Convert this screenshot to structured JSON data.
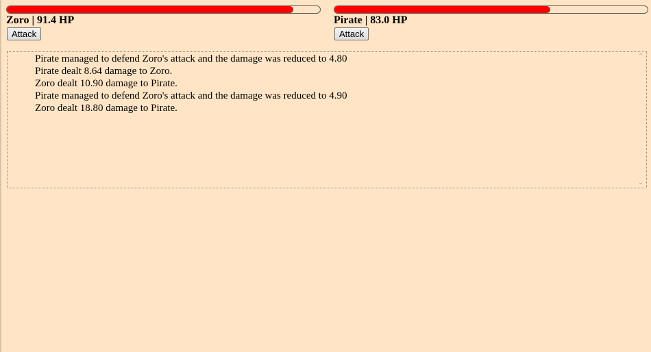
{
  "players": [
    {
      "name": "Zoro",
      "separator": "|",
      "hp_text": "91.4 HP",
      "hp_fraction": 0.914,
      "attack_label": "Attack"
    },
    {
      "name": "Pirate",
      "separator": "|",
      "hp_text": "83.0 HP",
      "hp_fraction": 0.69,
      "attack_label": "Attack"
    }
  ],
  "log": [
    "Pirate managed to defend Zoro's attack and the damage was reduced to 4.80",
    "Pirate dealt 8.64 damage to Zoro.",
    "Zoro dealt 10.90 damage to Pirate.",
    "Pirate managed to defend Zoro's attack and the damage was reduced to 4.90",
    "Zoro dealt 18.80 damage to Pirate."
  ],
  "colors": {
    "hp_fill": "#ff0000",
    "background": "#ffe5c6"
  },
  "icons": {
    "scroll_up": "chevron-up-icon",
    "scroll_down": "chevron-down-icon"
  }
}
